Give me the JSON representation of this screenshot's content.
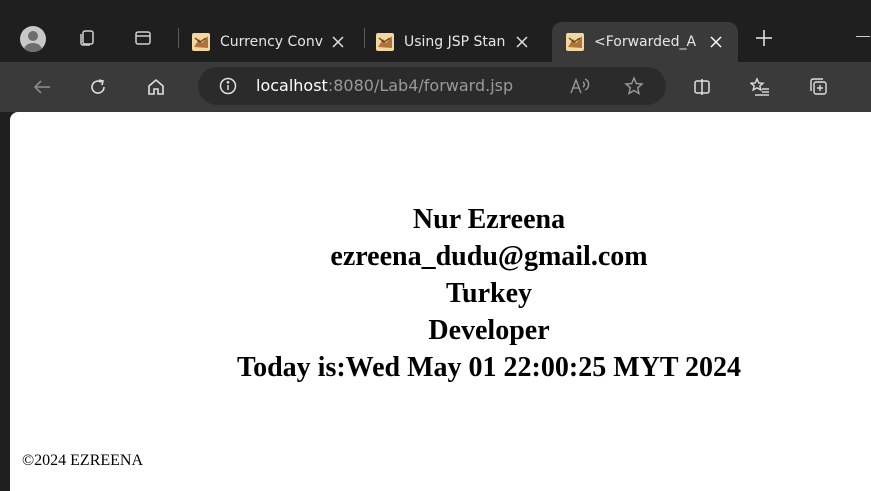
{
  "browser": {
    "tabs": [
      {
        "title": "Currency Conv",
        "favicon": "tomcat-favicon",
        "active": false
      },
      {
        "title": "Using JSP Stan",
        "favicon": "tomcat-favicon",
        "active": false
      },
      {
        "title": "<Forwarded_A",
        "favicon": "tomcat-favicon",
        "active": true
      }
    ],
    "address": {
      "host": "localhost",
      "path": ":8080/Lab4/forward.jsp"
    },
    "icons": {
      "profile": "profile-avatar-icon",
      "workspaces": "workspaces-icon",
      "tab_actions": "tab-actions-icon",
      "new_tab": "plus-icon",
      "back": "back-arrow-icon",
      "refresh": "refresh-icon",
      "home": "home-icon",
      "site_info": "info-icon",
      "read_aloud": "read-aloud-icon",
      "favorite": "star-icon",
      "split_screen": "split-screen-icon",
      "favorites_list": "favorites-list-icon",
      "collections": "collections-icon"
    },
    "colors": {
      "frame": "#1f1f1f",
      "toolbar": "#3a3a3a",
      "address_bar": "#2b2b2b",
      "page_background": "#ffffff"
    }
  },
  "page": {
    "name": "Nur Ezreena",
    "email": "ezreena_dudu@gmail.com",
    "country": "Turkey",
    "job": "Developer",
    "date_line": "Today is:Wed May 01 22:00:25 MYT 2024",
    "footer": "©2024 EZREENA"
  }
}
